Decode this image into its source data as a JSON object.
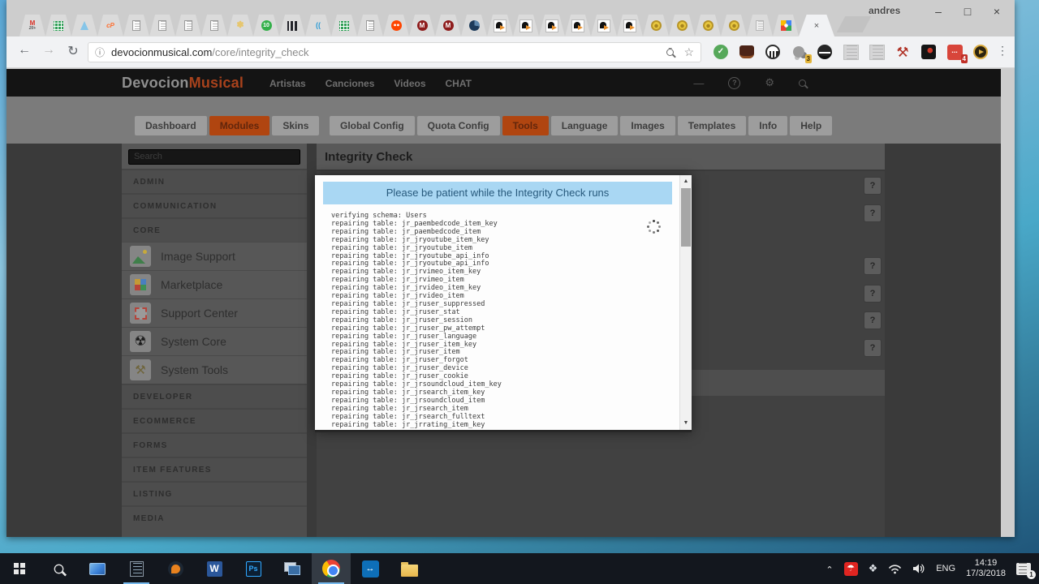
{
  "titlebar": {
    "profile": "andres",
    "minimize": "–",
    "maximize": "□",
    "close": "×"
  },
  "tabs": {
    "icons": [
      "gmail",
      "sheets",
      "flask",
      "cpanel",
      "doc",
      "doc",
      "doc",
      "doc",
      "flower",
      "ten",
      "panels",
      "waves",
      "sheets",
      "doc",
      "reddit",
      "mm",
      "mm",
      "pie",
      "bird",
      "bird",
      "bird",
      "bird",
      "bird",
      "bird",
      "coin",
      "coin",
      "coin",
      "coin",
      "docgray",
      "maps"
    ],
    "gmail_badge": "20+",
    "active_close": "×"
  },
  "toolbar": {
    "back": "←",
    "forward": "→",
    "reload": "↻",
    "info": "ⓘ",
    "star": "☆",
    "menu": "⋮",
    "url_host": "devocionmusical.com",
    "url_path": "/core/integrity_check",
    "extensions": [
      {
        "name": "ok-green",
        "badge": ""
      },
      {
        "name": "fox-dark",
        "badge": ""
      },
      {
        "name": "chart-circle",
        "badge": ""
      },
      {
        "name": "cluster",
        "badge": "3"
      },
      {
        "name": "spy",
        "badge": ""
      },
      {
        "name": "ghost-1",
        "badge": ""
      },
      {
        "name": "ghost-2",
        "badge": ""
      },
      {
        "name": "gavel-red",
        "badge": ""
      },
      {
        "name": "runner-dark",
        "badge": ""
      },
      {
        "name": "dots-red",
        "badge": "4"
      },
      {
        "name": "play-gold",
        "badge": ""
      }
    ],
    "ok_glyph": "✓",
    "dots_glyph": "...",
    "mm_glyph": "M",
    "gavel_glyph": "⚒"
  },
  "site": {
    "logo_a": "Devocion",
    "logo_b": "Musical",
    "nav": [
      "Artistas",
      "Canciones",
      "Videos",
      "CHAT"
    ],
    "header_dash": "—",
    "header_help": "?",
    "header_gear": "⚙"
  },
  "admin": {
    "left_tabs": [
      {
        "label": "Dashboard",
        "active": false
      },
      {
        "label": "Modules",
        "active": true
      },
      {
        "label": "Skins",
        "active": false
      }
    ],
    "right_tabs": [
      {
        "label": "Global Config",
        "active": false
      },
      {
        "label": "Quota Config",
        "active": false
      },
      {
        "label": "Tools",
        "active": true
      },
      {
        "label": "Language",
        "active": false
      },
      {
        "label": "Images",
        "active": false
      },
      {
        "label": "Templates",
        "active": false
      },
      {
        "label": "Info",
        "active": false
      },
      {
        "label": "Help",
        "active": false
      }
    ],
    "page_title": "Integrity Check",
    "help_button": "?",
    "active_color": "#b04510"
  },
  "sidebar": {
    "search_placeholder": "Search",
    "items": [
      {
        "type": "header",
        "label": "ADMIN"
      },
      {
        "type": "header",
        "label": "COMMUNICATION"
      },
      {
        "type": "header",
        "label": "CORE"
      },
      {
        "type": "module",
        "icon": "image",
        "label": "Image Support"
      },
      {
        "type": "module",
        "icon": "market",
        "label": "Marketplace"
      },
      {
        "type": "module",
        "icon": "support",
        "label": "Support Center"
      },
      {
        "type": "module",
        "icon": "score",
        "label": "System Core",
        "glyph": "☢"
      },
      {
        "type": "module",
        "icon": "stools",
        "label": "System Tools",
        "glyph": "⚒"
      },
      {
        "type": "header",
        "label": "DEVELOPER"
      },
      {
        "type": "header",
        "label": "ECOMMERCE"
      },
      {
        "type": "header",
        "label": "FORMS"
      },
      {
        "type": "header",
        "label": "ITEM FEATURES"
      },
      {
        "type": "header",
        "label": "LISTING"
      },
      {
        "type": "header",
        "label": "MEDIA"
      }
    ]
  },
  "modal": {
    "banner": "Please be patient while the Integrity Check runs",
    "banner_bg": "#a9d7f3",
    "banner_text_color": "#27597c",
    "log": [
      "verifying schema: Users",
      "repairing table: jr_paembedcode_item_key",
      "repairing table: jr_paembedcode_item",
      "repairing table: jr_jryoutube_item_key",
      "repairing table: jr_jryoutube_item",
      "repairing table: jr_jryoutube_api_info",
      "repairing table: jr_jryoutube_api_info",
      "repairing table: jr_jrvimeo_item_key",
      "repairing table: jr_jrvimeo_item",
      "repairing table: jr_jrvideo_item_key",
      "repairing table: jr_jrvideo_item",
      "repairing table: jr_jruser_suppressed",
      "repairing table: jr_jruser_stat",
      "repairing table: jr_jruser_session",
      "repairing table: jr_jruser_pw_attempt",
      "repairing table: jr_jruser_language",
      "repairing table: jr_jruser_item_key",
      "repairing table: jr_jruser_item",
      "repairing table: jr_jruser_forgot",
      "repairing table: jr_jruser_device",
      "repairing table: jr_jruser_cookie",
      "repairing table: jr_jrsoundcloud_item_key",
      "repairing table: jr_jrsearch_item_key",
      "repairing table: jr_jrsoundcloud_item",
      "repairing table: jr_jrsearch_item",
      "repairing table: jr_jrsearch_fulltext",
      "repairing table: jr_jrrating_item_key"
    ]
  },
  "taskbar": {
    "word_label": "W",
    "ps_label": "Ps",
    "tv_label": "↔",
    "avira_glyph": "☂",
    "dropbox_glyph": "❖",
    "chevron": "⌃",
    "lang": "ENG",
    "time": "14:19",
    "date": "17/3/2018",
    "notif_badge": "1"
  }
}
